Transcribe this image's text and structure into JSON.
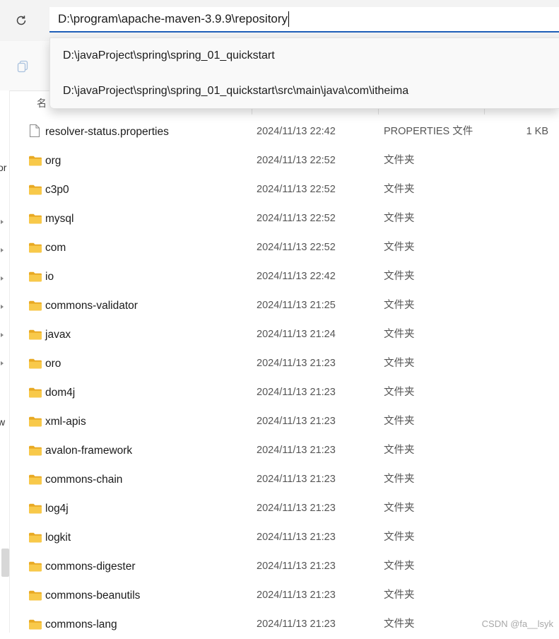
{
  "address_bar": {
    "path": "D:\\program\\apache-maven-3.9.9\\repository"
  },
  "suggestions": [
    "D:\\javaProject\\spring\\spring_01_quickstart",
    "D:\\javaProject\\spring\\spring_01_quickstart\\src\\main\\java\\com\\itheima"
  ],
  "columns": {
    "name_header": "名"
  },
  "nav_pane": {
    "fragment_1": "or",
    "fragment_2": "w"
  },
  "files": [
    {
      "name": "resolver-status.properties",
      "date": "2024/11/13 22:42",
      "type": "PROPERTIES 文件",
      "size": "1 KB",
      "icon": "file-icon"
    },
    {
      "name": "org",
      "date": "2024/11/13 22:52",
      "type": "文件夹",
      "size": "",
      "icon": "folder-icon"
    },
    {
      "name": "c3p0",
      "date": "2024/11/13 22:52",
      "type": "文件夹",
      "size": "",
      "icon": "folder-icon"
    },
    {
      "name": "mysql",
      "date": "2024/11/13 22:52",
      "type": "文件夹",
      "size": "",
      "icon": "folder-icon"
    },
    {
      "name": "com",
      "date": "2024/11/13 22:52",
      "type": "文件夹",
      "size": "",
      "icon": "folder-icon"
    },
    {
      "name": "io",
      "date": "2024/11/13 22:42",
      "type": "文件夹",
      "size": "",
      "icon": "folder-icon"
    },
    {
      "name": "commons-validator",
      "date": "2024/11/13 21:25",
      "type": "文件夹",
      "size": "",
      "icon": "folder-icon"
    },
    {
      "name": "javax",
      "date": "2024/11/13 21:24",
      "type": "文件夹",
      "size": "",
      "icon": "folder-icon"
    },
    {
      "name": "oro",
      "date": "2024/11/13 21:23",
      "type": "文件夹",
      "size": "",
      "icon": "folder-icon"
    },
    {
      "name": "dom4j",
      "date": "2024/11/13 21:23",
      "type": "文件夹",
      "size": "",
      "icon": "folder-icon"
    },
    {
      "name": "xml-apis",
      "date": "2024/11/13 21:23",
      "type": "文件夹",
      "size": "",
      "icon": "folder-icon"
    },
    {
      "name": "avalon-framework",
      "date": "2024/11/13 21:23",
      "type": "文件夹",
      "size": "",
      "icon": "folder-icon"
    },
    {
      "name": "commons-chain",
      "date": "2024/11/13 21:23",
      "type": "文件夹",
      "size": "",
      "icon": "folder-icon"
    },
    {
      "name": "log4j",
      "date": "2024/11/13 21:23",
      "type": "文件夹",
      "size": "",
      "icon": "folder-icon"
    },
    {
      "name": "logkit",
      "date": "2024/11/13 21:23",
      "type": "文件夹",
      "size": "",
      "icon": "folder-icon"
    },
    {
      "name": "commons-digester",
      "date": "2024/11/13 21:23",
      "type": "文件夹",
      "size": "",
      "icon": "folder-icon"
    },
    {
      "name": "commons-beanutils",
      "date": "2024/11/13 21:23",
      "type": "文件夹",
      "size": "",
      "icon": "folder-icon"
    },
    {
      "name": "commons-lang",
      "date": "2024/11/13 21:23",
      "type": "文件夹",
      "size": "",
      "icon": "folder-icon"
    }
  ],
  "watermark": "CSDN @fa__lsyk",
  "colors": {
    "accent": "#1f5fb8",
    "folder": "#f8c94a",
    "folder_dark": "#e8a923"
  }
}
